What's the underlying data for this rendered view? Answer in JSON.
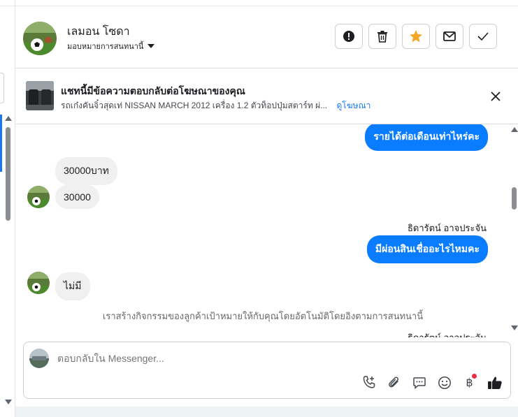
{
  "contact": {
    "name": "เลมอน โซดา",
    "assignment": "มอบหมายการสนทนานี้"
  },
  "header_actions": [
    {
      "name": "report-spam",
      "icon": "exclamation-icon"
    },
    {
      "name": "delete",
      "icon": "trash-icon"
    },
    {
      "name": "star",
      "icon": "star-icon",
      "color": "#f5a623"
    },
    {
      "name": "mark-unread",
      "icon": "envelope-icon"
    },
    {
      "name": "mark-done",
      "icon": "check-icon"
    }
  ],
  "ad_banner": {
    "title": "แชทนี้มีข้อความตอบกลับต่อโฆษณาของคุณ",
    "description": "รถเก๋งคันจิ๋วสุดเท่ NISSAN MARCH 2012 เครื่อง 1.2 ตัวท็อปปุ่มสตาร์ท ผ่...",
    "link": "ดูโฆษณา"
  },
  "messages": {
    "out1": "รายได้ต่อเดือนเท่าไหร่คะ",
    "in1": "30000บาท",
    "in2": "30000",
    "sender": "ธิดารัตน์ อาจประจัน",
    "out2": "มีผ่อนสินเชื่ออะไรไหมคะ",
    "in3": "ไม่มี",
    "system_note": "เราสร้างกิจกรรมของลูกค้าเป้าหมายให้กับคุณโดยอัตโนมัติโดยอิงตามการสนทนานี้",
    "cut_text": "ธิดารัตน์ อาจประจัน"
  },
  "composer": {
    "placeholder": "ตอบกลับใน Messenger...",
    "baht_symbol": "฿"
  },
  "colors": {
    "accent": "#0a7cff",
    "link": "#1877f2",
    "notification": "#f02849"
  }
}
